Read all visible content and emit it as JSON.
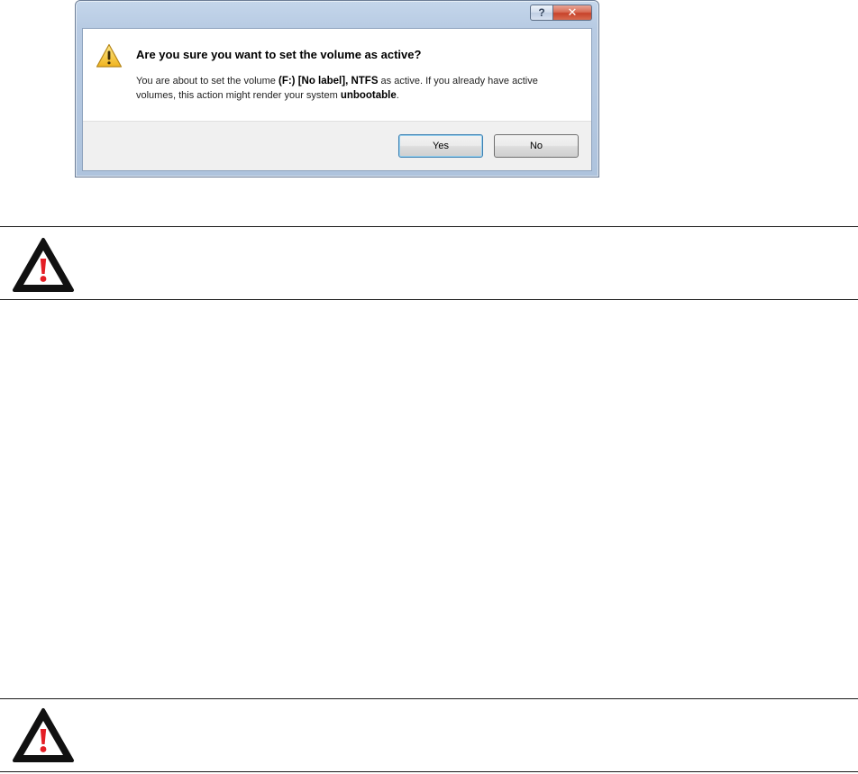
{
  "dialog": {
    "title_buttons": {
      "help_glyph": "?",
      "close_glyph": "✕"
    },
    "main_instruction": "Are you sure you want to set the volume as active?",
    "message": {
      "part1": "You are about to set the volume ",
      "volume": "(F:) [No label], NTFS",
      "part2": " as active. If you already have active volumes, this action might render your system ",
      "emphasis": "unbootable",
      "part3": "."
    },
    "buttons": {
      "yes": "Yes",
      "no": "No"
    },
    "icon": "warning-triangle-icon"
  },
  "warning_boxes": [
    {
      "icon": "caution-triangle-icon"
    },
    {
      "icon": "caution-triangle-icon"
    }
  ],
  "colors": {
    "frame": "#b8cbe3",
    "close_button": "#c7422a",
    "warning_yellow": "#f7c634",
    "caution_red": "#e41e25"
  }
}
